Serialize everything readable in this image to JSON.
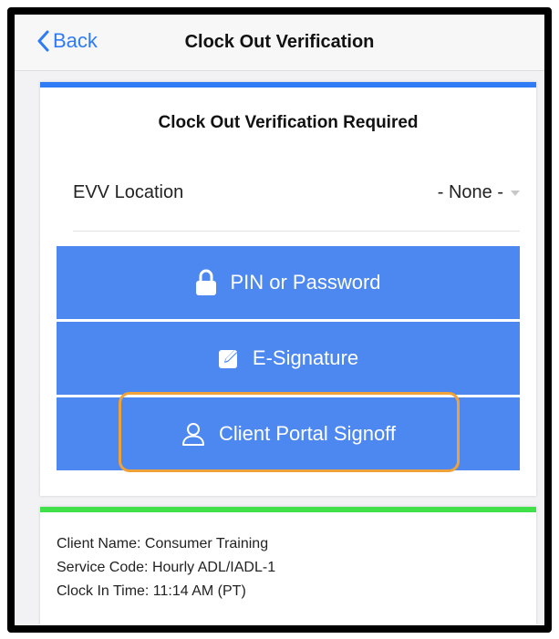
{
  "nav": {
    "back_label": "Back",
    "title": "Clock Out Verification"
  },
  "card": {
    "title": "Clock Out Verification Required",
    "evv_label": "EVV Location",
    "evv_value": "- None -"
  },
  "buttons": {
    "pin": "PIN or Password",
    "esig": "E-Signature",
    "portal": "Client Portal Signoff"
  },
  "info": {
    "client_name": "Client Name: Consumer Training",
    "service_code": "Service Code: Hourly ADL/IADL-1",
    "clock_in": "Clock In Time: 11:14 AM (PT)"
  },
  "colors": {
    "accent_blue": "#2f7bf5",
    "button_blue": "#4d88f0",
    "status_green": "#3fe04a",
    "highlight_orange": "#f0a23a"
  },
  "icons": [
    "back-chevron-icon",
    "lock-icon",
    "edit-signature-icon",
    "user-icon"
  ]
}
